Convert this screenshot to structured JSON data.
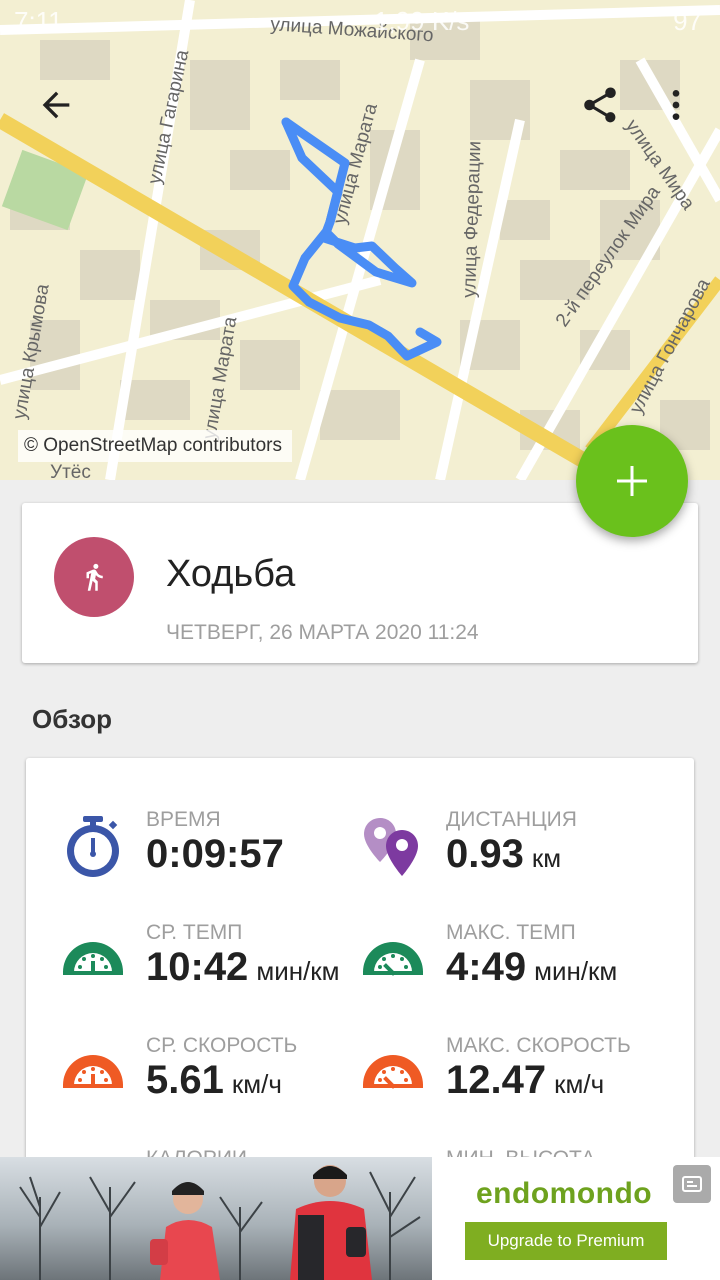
{
  "status_bar": {
    "time": "7:11",
    "network": "1,99 K/s",
    "battery": "97"
  },
  "map": {
    "credit": "© OpenStreetMap contributors",
    "streets": [
      "улица Можайского",
      "улица Гагарина",
      "улица Марата",
      "улица Федерации",
      "улица Мира",
      "2-й переулок Мира",
      "улица Гончарова",
      "улица Крымова",
      "улица Марата",
      "Утёс"
    ]
  },
  "toolbar": {
    "back_icon": "arrow-back-icon",
    "share_icon": "share-icon",
    "more_icon": "more-vert-icon"
  },
  "fab": {
    "icon": "plus-icon",
    "color": "#6ac11c"
  },
  "workout": {
    "title": "Ходьба",
    "date": "ЧЕТВЕРГ, 26 МАРТА 2020 11:24",
    "icon": "walking-icon",
    "icon_color": "#c04f6e"
  },
  "overview": {
    "title": "Обзор",
    "stats": [
      {
        "label": "ВРЕМЯ",
        "value": "0:09:57",
        "unit": "",
        "icon": "stopwatch-icon"
      },
      {
        "label": "ДИСТАНЦИЯ",
        "value": "0.93",
        "unit": "км",
        "icon": "location-pins-icon"
      },
      {
        "label": "СР. ТЕМП",
        "value": "10:42",
        "unit": "мин/км",
        "icon": "gauge-green-icon"
      },
      {
        "label": "МАКС. ТЕМП",
        "value": "4:49",
        "unit": "мин/км",
        "icon": "gauge-green-icon"
      },
      {
        "label": "СР. СКОРОСТЬ",
        "value": "5.61",
        "unit": "км/ч",
        "icon": "gauge-orange-icon"
      },
      {
        "label": "МАКС. СКОРОСТЬ",
        "value": "12.47",
        "unit": "км/ч",
        "icon": "gauge-orange-icon"
      },
      {
        "label": "КАЛОРИИ",
        "value": "",
        "unit": ""
      },
      {
        "label": "МИН. ВЫСОТА",
        "value": "",
        "unit": ""
      }
    ]
  },
  "ad": {
    "brand": "endomondo",
    "button": "Upgrade to Premium",
    "accent": "#7fae21"
  }
}
